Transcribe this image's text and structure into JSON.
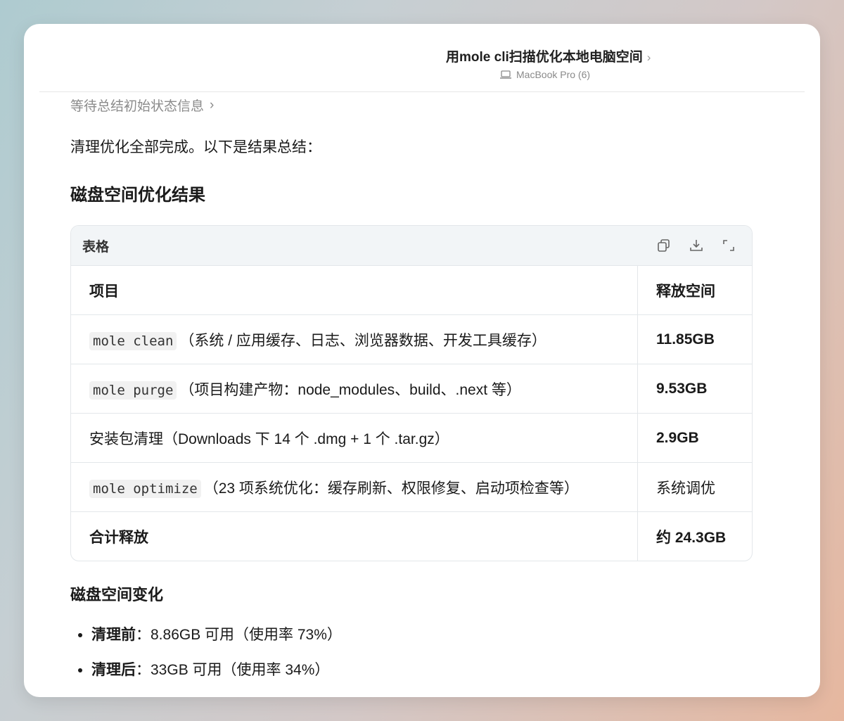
{
  "header": {
    "title": "用mole cli扫描优化本地电脑空间",
    "title_chevron": "›",
    "device": "MacBook Pro (6)"
  },
  "summary_link": {
    "label": "等待总结初始状态信息",
    "chevron": "›"
  },
  "intro": "清理优化全部完成。以下是结果总结：",
  "section_title": "磁盘空间优化结果",
  "table": {
    "toolbar_label": "表格",
    "toolbar_icons": [
      "copy-icon",
      "download-icon",
      "expand-icon"
    ],
    "headers": [
      "项目",
      "释放空间"
    ],
    "rows": [
      {
        "code": "mole clean",
        "text": "（系统 / 应用缓存、日志、浏览器数据、开发工具缓存）",
        "value": "11.85GB",
        "value_bold": true
      },
      {
        "code": "mole purge",
        "text": "（项目构建产物：node_modules、build、.next 等）",
        "value": "9.53GB",
        "value_bold": true
      },
      {
        "code": "",
        "text": "安装包清理（Downloads 下 14 个 .dmg + 1 个 .tar.gz）",
        "value": "2.9GB",
        "value_bold": true
      },
      {
        "code": "mole optimize",
        "text": "（23 项系统优化：缓存刷新、权限修复、启动项检查等）",
        "value": "系统调优",
        "value_bold": false
      },
      {
        "code": "",
        "text": "合计释放",
        "value": "约 24.3GB",
        "value_bold": true,
        "label_bold": true
      }
    ]
  },
  "disk_change": {
    "title": "磁盘空间变化",
    "items": [
      {
        "label": "清理前",
        "text": "：8.86GB 可用（使用率 73%）"
      },
      {
        "label": "清理后",
        "text": "：33GB 可用（使用率 34%）"
      }
    ]
  }
}
